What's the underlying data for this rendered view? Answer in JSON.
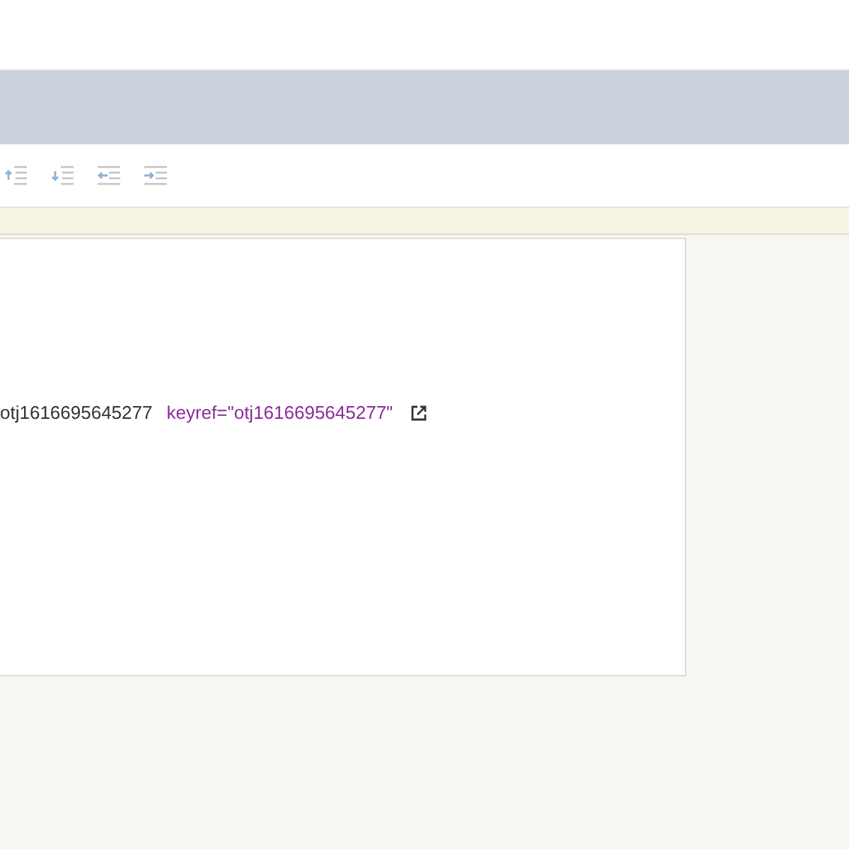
{
  "toolbar": {
    "icons": [
      {
        "kind": "move-up"
      },
      {
        "kind": "move-down"
      },
      {
        "kind": "outdent"
      },
      {
        "kind": "indent"
      }
    ]
  },
  "content": {
    "id_text": "otj1616695645277",
    "keyref_text": "keyref=\"otj1616695645277\""
  }
}
